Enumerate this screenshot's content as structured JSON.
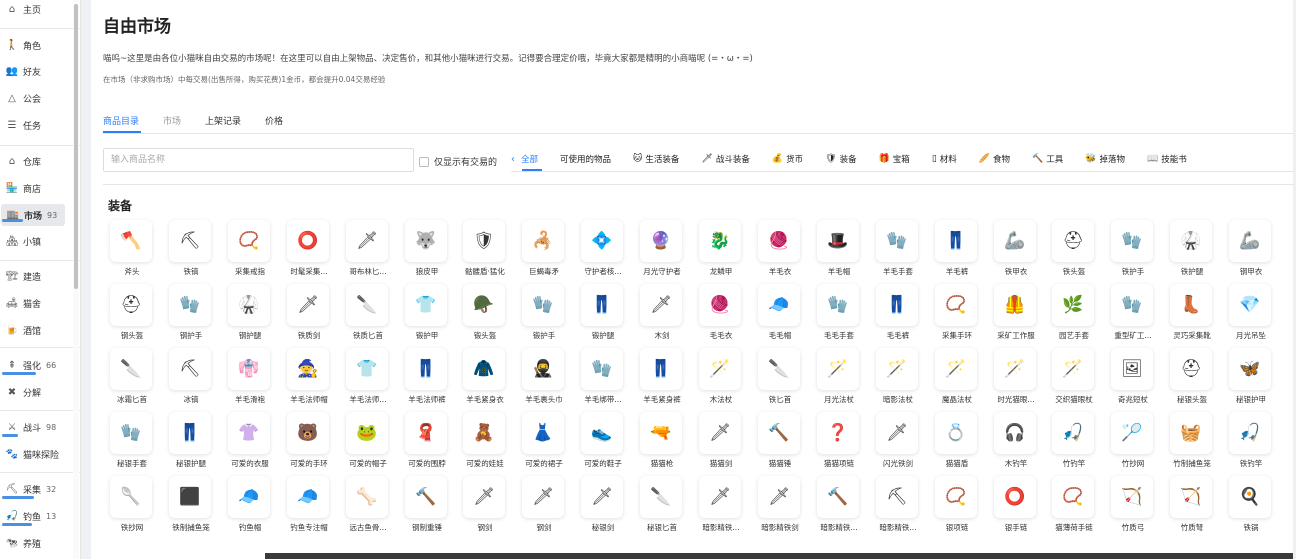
{
  "sidebar": {
    "items": [
      {
        "label": "主页",
        "icon": "home-icon",
        "glyph": "⌂",
        "num": "",
        "active": false
      },
      {
        "label": "角色",
        "icon": "person-icon",
        "glyph": "🚶",
        "num": "",
        "active": false
      },
      {
        "label": "好友",
        "icon": "friends-icon",
        "glyph": "👥",
        "num": "",
        "active": false
      },
      {
        "label": "公会",
        "icon": "guild-icon",
        "glyph": "△",
        "num": "",
        "active": false
      },
      {
        "label": "任务",
        "icon": "task-list-icon",
        "glyph": "☰",
        "num": "",
        "active": false
      },
      {
        "label": "仓库",
        "icon": "warehouse-icon",
        "glyph": "⌂",
        "num": "",
        "active": false
      },
      {
        "label": "商店",
        "icon": "shop-icon",
        "glyph": "🏪",
        "num": "",
        "active": false
      },
      {
        "label": "市场",
        "icon": "market-icon",
        "glyph": "🏬",
        "num": "93",
        "active": true
      },
      {
        "label": "小镇",
        "icon": "town-icon",
        "glyph": "🏘",
        "num": "",
        "active": false
      },
      {
        "label": "建造",
        "icon": "build-icon",
        "glyph": "🏗",
        "num": "",
        "active": false
      },
      {
        "label": "猫舍",
        "icon": "cattery-icon",
        "glyph": "🛋",
        "num": "",
        "active": false
      },
      {
        "label": "酒馆",
        "icon": "tavern-icon",
        "glyph": "🍺",
        "num": "",
        "active": false
      },
      {
        "label": "强化",
        "icon": "enhance-icon",
        "glyph": "⇞",
        "num": "66",
        "active": false
      },
      {
        "label": "分解",
        "icon": "decompose-icon",
        "glyph": "✖",
        "num": "",
        "active": false
      },
      {
        "label": "战斗",
        "icon": "battle-icon",
        "glyph": "⚔",
        "num": "98",
        "active": false
      },
      {
        "label": "猫咪探险",
        "icon": "explore-icon",
        "glyph": "🐾",
        "num": "",
        "active": false
      },
      {
        "label": "采集",
        "icon": "gather-icon",
        "glyph": "⛏",
        "num": "32",
        "active": false
      },
      {
        "label": "钓鱼",
        "icon": "fishing-icon",
        "glyph": "🎣",
        "num": "13",
        "active": false
      },
      {
        "label": "养殖",
        "icon": "farming-icon",
        "glyph": "🐄",
        "num": "",
        "active": false
      }
    ],
    "progress": {
      "market": 0.36,
      "enhance": 0.67,
      "battle": 0.32,
      "gather": 0.63,
      "fishing": 0.6
    }
  },
  "page": {
    "title": "自由市场",
    "description": "喵呜~这里是由各位小猫咪自由交易的市场呢！在这里可以自由上架物品、决定售价，和其他小猫咪进行交易。记得要合理定价哦，毕竟大家都是精明的小商喵呢 (=・ω・=)",
    "fee_note": "在市场（非求购市场）中每交易(出售所得，购买花费)1金币，都会提升0.04交易经验"
  },
  "tabs": [
    {
      "label": "商品目录",
      "state": "active"
    },
    {
      "label": "市场",
      "state": "dim"
    },
    {
      "label": "上架记录",
      "state": "normal"
    },
    {
      "label": "价格",
      "state": "normal"
    }
  ],
  "search": {
    "placeholder": "输入商品名称",
    "value": ""
  },
  "only_tradable_label": "仅显示有交易的",
  "categories": [
    {
      "label": "全部",
      "icon": "",
      "glyph": "",
      "active": true
    },
    {
      "label": "可使用的物品",
      "icon": "",
      "glyph": "",
      "active": false
    },
    {
      "label": "生活装备",
      "icon": "pet-cat-icon",
      "glyph": "🐱",
      "active": false
    },
    {
      "label": "战斗装备",
      "icon": "sword-icon",
      "glyph": "🗡",
      "active": false
    },
    {
      "label": "货币",
      "icon": "coin-icon",
      "glyph": "💰",
      "active": false
    },
    {
      "label": "装备",
      "icon": "shield-icon",
      "glyph": "🛡",
      "active": false
    },
    {
      "label": "宝箱",
      "icon": "chest-icon",
      "glyph": "🎁",
      "active": false
    },
    {
      "label": "材料",
      "icon": "material-icon",
      "glyph": "▯",
      "active": false
    },
    {
      "label": "食物",
      "icon": "food-icon",
      "glyph": "🥖",
      "active": false
    },
    {
      "label": "工具",
      "icon": "hammer-icon",
      "glyph": "🔨",
      "active": false
    },
    {
      "label": "掉落物",
      "icon": "drop-icon",
      "glyph": "🐝",
      "active": false
    },
    {
      "label": "技能书",
      "icon": "book-icon",
      "glyph": "📖",
      "active": false
    }
  ],
  "section_title": "装备",
  "items": [
    {
      "name": "斧头",
      "icon": "axe-icon",
      "glyph": "🪓"
    },
    {
      "name": "铁镐",
      "icon": "pickaxe-icon",
      "glyph": "⛏"
    },
    {
      "name": "采集戒指",
      "icon": "ring-icon",
      "glyph": "📿"
    },
    {
      "name": "时髦采集...",
      "icon": "ring-icon",
      "glyph": "⭕"
    },
    {
      "name": "哥布林匕...",
      "icon": "dagger-icon",
      "glyph": "🗡"
    },
    {
      "name": "狼皮甲",
      "icon": "armor-icon",
      "glyph": "🐺"
    },
    {
      "name": "骷髅盾·猛化",
      "icon": "shield-icon",
      "glyph": "🛡"
    },
    {
      "name": "巨蝎毒矛",
      "icon": "spear-icon",
      "glyph": "🦂"
    },
    {
      "name": "守护者核...",
      "icon": "core-icon",
      "glyph": "💠"
    },
    {
      "name": "月光守护者",
      "icon": "amulet-icon",
      "glyph": "🔮"
    },
    {
      "name": "龙鳞甲",
      "icon": "armor-icon",
      "glyph": "🐉"
    },
    {
      "name": "羊毛衣",
      "icon": "wool-icon",
      "glyph": "🧶"
    },
    {
      "name": "羊毛帽",
      "icon": "hat-icon",
      "glyph": "🎩"
    },
    {
      "name": "羊毛手套",
      "icon": "glove-icon",
      "glyph": "🧤"
    },
    {
      "name": "羊毛裤",
      "icon": "pants-icon",
      "glyph": "👖"
    },
    {
      "name": "铁甲衣",
      "icon": "armor-icon",
      "glyph": "🦾"
    },
    {
      "name": "铁头盔",
      "icon": "helmet-icon",
      "glyph": "⛑"
    },
    {
      "name": "铁护手",
      "icon": "glove-icon",
      "glyph": "🧤"
    },
    {
      "name": "铁护腿",
      "icon": "legging-icon",
      "glyph": "🥋"
    },
    {
      "name": "钢甲衣",
      "icon": "armor-icon",
      "glyph": "🦾"
    },
    {
      "name": "钢头盔",
      "icon": "helmet-icon",
      "glyph": "⛑"
    },
    {
      "name": "钢护手",
      "icon": "glove-icon",
      "glyph": "🧤"
    },
    {
      "name": "钢护腿",
      "icon": "legging-icon",
      "glyph": "🥋"
    },
    {
      "name": "铁质剑",
      "icon": "sword-icon",
      "glyph": "🗡"
    },
    {
      "name": "铁质匕首",
      "icon": "dagger-icon",
      "glyph": "🔪"
    },
    {
      "name": "锻护甲",
      "icon": "armor-icon",
      "glyph": "👕"
    },
    {
      "name": "锻头盔",
      "icon": "helmet-icon",
      "glyph": "🪖"
    },
    {
      "name": "锻护手",
      "icon": "glove-icon",
      "glyph": "🧤"
    },
    {
      "name": "锻护腿",
      "icon": "legging-icon",
      "glyph": "👖"
    },
    {
      "name": "木剑",
      "icon": "sword-icon",
      "glyph": "🗡"
    },
    {
      "name": "毛毛衣",
      "icon": "wool-icon",
      "glyph": "🧶"
    },
    {
      "name": "毛毛帽",
      "icon": "hat-icon",
      "glyph": "🧢"
    },
    {
      "name": "毛毛手套",
      "icon": "glove-icon",
      "glyph": "🧤"
    },
    {
      "name": "毛毛裤",
      "icon": "pants-icon",
      "glyph": "👖"
    },
    {
      "name": "采集手环",
      "icon": "bracelet-icon",
      "glyph": "📿"
    },
    {
      "name": "采矿工作服",
      "icon": "vest-icon",
      "glyph": "🦺"
    },
    {
      "name": "园艺手套",
      "icon": "glove-icon",
      "glyph": "🌿"
    },
    {
      "name": "重型矿工...",
      "icon": "glove-icon",
      "glyph": "🧤"
    },
    {
      "name": "灵巧采集靴",
      "icon": "boot-icon",
      "glyph": "👢"
    },
    {
      "name": "月光吊坠",
      "icon": "pendant-icon",
      "glyph": "💎"
    },
    {
      "name": "冰霜匕首",
      "icon": "dagger-icon",
      "glyph": "🔪"
    },
    {
      "name": "冰镐",
      "icon": "pickaxe-icon",
      "glyph": "⛏"
    },
    {
      "name": "羊毛滑袍",
      "icon": "robe-icon",
      "glyph": "👘"
    },
    {
      "name": "羊毛法师帽",
      "icon": "hat-icon",
      "glyph": "🧙"
    },
    {
      "name": "羊毛法师...",
      "icon": "robe-icon",
      "glyph": "👕"
    },
    {
      "name": "羊毛法师裤",
      "icon": "pants-icon",
      "glyph": "👖"
    },
    {
      "name": "羊毛紧身衣",
      "icon": "shirt-icon",
      "glyph": "🧥"
    },
    {
      "name": "羊毛裹头巾",
      "icon": "hood-icon",
      "glyph": "🥷"
    },
    {
      "name": "羊毛绑带...",
      "icon": "glove-icon",
      "glyph": "🧤"
    },
    {
      "name": "羊毛紧身裤",
      "icon": "pants-icon",
      "glyph": "👖"
    },
    {
      "name": "木法杖",
      "icon": "staff-icon",
      "glyph": "🪄"
    },
    {
      "name": "铁匕首",
      "icon": "dagger-icon",
      "glyph": "🔪"
    },
    {
      "name": "月光法杖",
      "icon": "staff-icon",
      "glyph": "🪄"
    },
    {
      "name": "暗影法杖",
      "icon": "staff-icon",
      "glyph": "🪄"
    },
    {
      "name": "魔晶法杖",
      "icon": "staff-icon",
      "glyph": "🪄"
    },
    {
      "name": "时光猫眼...",
      "icon": "staff-icon",
      "glyph": "🪄"
    },
    {
      "name": "交织猫眼杖",
      "icon": "staff-icon",
      "glyph": "🪄"
    },
    {
      "name": "奇兆短杖",
      "icon": "broken-image-icon",
      "glyph": "🖼"
    },
    {
      "name": "秘银头盔",
      "icon": "helmet-icon",
      "glyph": "⛑"
    },
    {
      "name": "秘银护甲",
      "icon": "armor-icon",
      "glyph": "🦋"
    },
    {
      "name": "秘银手套",
      "icon": "glove-icon",
      "glyph": "🧤"
    },
    {
      "name": "秘银护腿",
      "icon": "legging-icon",
      "glyph": "👖"
    },
    {
      "name": "可爱的衣服",
      "icon": "clothes-icon",
      "glyph": "👚"
    },
    {
      "name": "可爱的手环",
      "icon": "bracelet-icon",
      "glyph": "🐻"
    },
    {
      "name": "可爱的帽子",
      "icon": "hat-icon",
      "glyph": "🐸"
    },
    {
      "name": "可爱的围脖",
      "icon": "scarf-icon",
      "glyph": "🧣"
    },
    {
      "name": "可爱的娃娃",
      "icon": "doll-icon",
      "glyph": "🧸"
    },
    {
      "name": "可爱的裙子",
      "icon": "dress-icon",
      "glyph": "👗"
    },
    {
      "name": "可爱的鞋子",
      "icon": "shoe-icon",
      "glyph": "👟"
    },
    {
      "name": "猫猫枪",
      "icon": "gun-icon",
      "glyph": "🔫"
    },
    {
      "name": "猫猫剑",
      "icon": "sword-icon",
      "glyph": "🗡"
    },
    {
      "name": "猫猫锤",
      "icon": "hammer-icon",
      "glyph": "🔨"
    },
    {
      "name": "猫猫项链",
      "icon": "question-icon",
      "glyph": "❓"
    },
    {
      "name": "闪光铁剑",
      "icon": "sword-icon",
      "glyph": "🗡"
    },
    {
      "name": "猫猫盾",
      "icon": "shield-icon",
      "glyph": "💍"
    },
    {
      "name": "木钓竿",
      "icon": "fishing-rod-icon",
      "glyph": "🎧"
    },
    {
      "name": "竹钓竿",
      "icon": "fishing-rod-icon",
      "glyph": "🎣"
    },
    {
      "name": "竹抄网",
      "icon": "net-icon",
      "glyph": "🏸"
    },
    {
      "name": "竹制捕鱼笼",
      "icon": "trap-icon",
      "glyph": "🧺"
    },
    {
      "name": "铁钓竿",
      "icon": "fishing-rod-icon",
      "glyph": "🎣"
    },
    {
      "name": "铁抄网",
      "icon": "net-icon",
      "glyph": "🥄"
    },
    {
      "name": "铁制捕鱼笼",
      "icon": "trap-icon",
      "glyph": "⬛"
    },
    {
      "name": "钓鱼帽",
      "icon": "cap-icon",
      "glyph": "🧢"
    },
    {
      "name": "钓鱼专注帽",
      "icon": "cap-icon",
      "glyph": "🧢"
    },
    {
      "name": "远古鱼骨...",
      "icon": "fish-bone-icon",
      "glyph": "🦴"
    },
    {
      "name": "钢制重锤",
      "icon": "hammer-icon",
      "glyph": "🔨"
    },
    {
      "name": "钢剑",
      "icon": "sword-icon",
      "glyph": "🗡"
    },
    {
      "name": "钢剑",
      "icon": "sword-icon",
      "glyph": "🗡"
    },
    {
      "name": "秘银剑",
      "icon": "sword-icon",
      "glyph": "🗡"
    },
    {
      "name": "秘银匕首",
      "icon": "dagger-icon",
      "glyph": "🔪"
    },
    {
      "name": "暗影精铁...",
      "icon": "sword-icon",
      "glyph": "🗡"
    },
    {
      "name": "暗影精铁剑",
      "icon": "sword-icon",
      "glyph": "🗡"
    },
    {
      "name": "暗影精铁...",
      "icon": "hammer-icon",
      "glyph": "🔨"
    },
    {
      "name": "暗影精铁...",
      "icon": "pickaxe-icon",
      "glyph": "⛏"
    },
    {
      "name": "银项链",
      "icon": "necklace-icon",
      "glyph": "📿"
    },
    {
      "name": "银手链",
      "icon": "bracelet-icon",
      "glyph": "⭕"
    },
    {
      "name": "猫薄荷手链",
      "icon": "bracelet-icon",
      "glyph": "📿"
    },
    {
      "name": "竹质弓",
      "icon": "bow-icon",
      "glyph": "🏹"
    },
    {
      "name": "竹质弩",
      "icon": "crossbow-icon",
      "glyph": "🏹"
    },
    {
      "name": "铁锅",
      "icon": "pan-icon",
      "glyph": "🍳"
    }
  ],
  "colors": {
    "accent": "#2d7ff9",
    "progress": "#4a90e2"
  }
}
